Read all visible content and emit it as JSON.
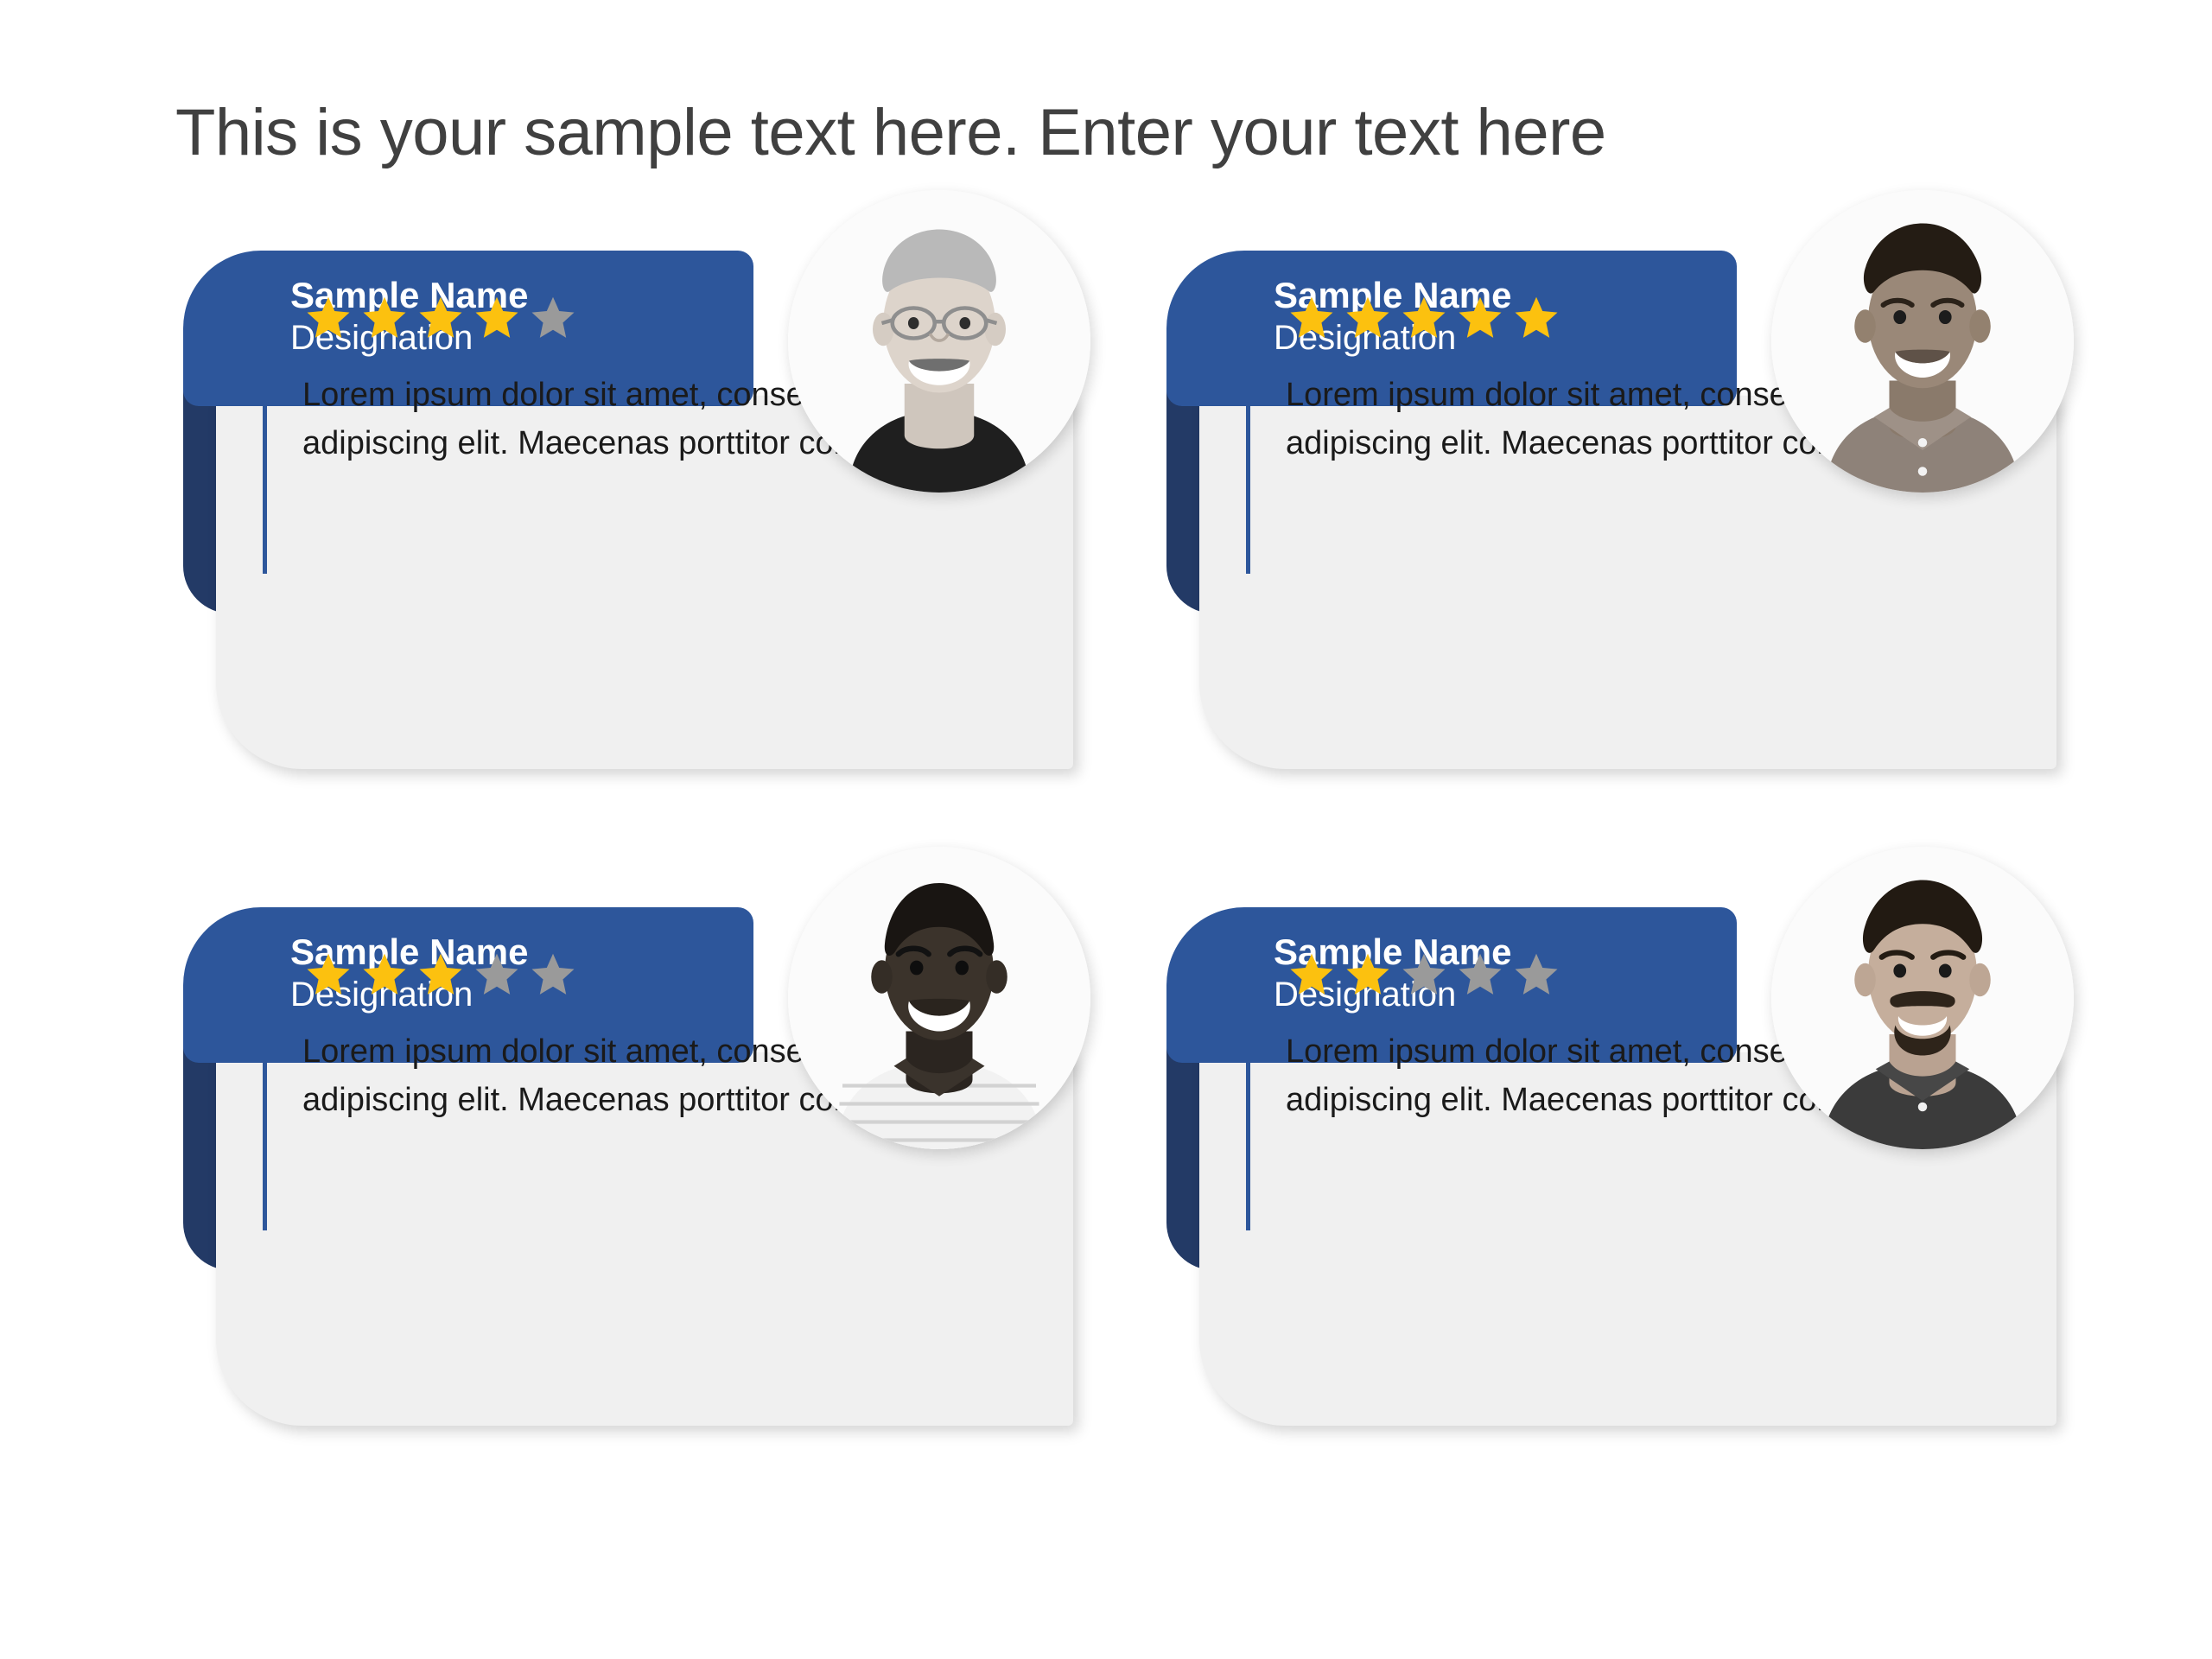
{
  "slide": {
    "title": "This is your sample text here. Enter your text here",
    "background_color": "#ffffff"
  },
  "theme": {
    "brand_blue": "#2d569b",
    "brand_blue_dark": "#233a66",
    "card_body_gray": "#f0f0f0",
    "star_gold": "#fcc10f",
    "star_gray": "#9a9a9a",
    "title_color": "#404040",
    "body_text_color": "#1a1a1a"
  },
  "cards": [
    {
      "name": "Sample Name",
      "designation": "Designation",
      "rating": 4,
      "max_rating": 5,
      "quote": "Lorem ipsum dolor sit amet, consectetuer adipiscing elit. Maecenas porttitor congue",
      "avatar_alt": "older-man-with-glasses-black-tshirt"
    },
    {
      "name": "Sample Name",
      "designation": "Designation",
      "rating": 5,
      "max_rating": 5,
      "quote": "Lorem ipsum dolor sit amet, consectetuer adipiscing elit. Maecenas porttitor congue",
      "avatar_alt": "young-man-dark-hair-polo-shirt"
    },
    {
      "name": "Sample Name",
      "designation": "Designation",
      "rating": 3,
      "max_rating": 5,
      "quote": "Lorem ipsum dolor sit amet, consectetuer adipiscing elit. Maecenas porttitor congue",
      "avatar_alt": "smiling-bald-man-striped-shirt"
    },
    {
      "name": "Sample Name",
      "designation": "Designation",
      "rating": 2,
      "max_rating": 5,
      "quote": "Lorem ipsum dolor sit amet, consectetuer adipiscing elit. Maecenas porttitor congue",
      "avatar_alt": "man-with-mustache-dark-polo"
    }
  ]
}
